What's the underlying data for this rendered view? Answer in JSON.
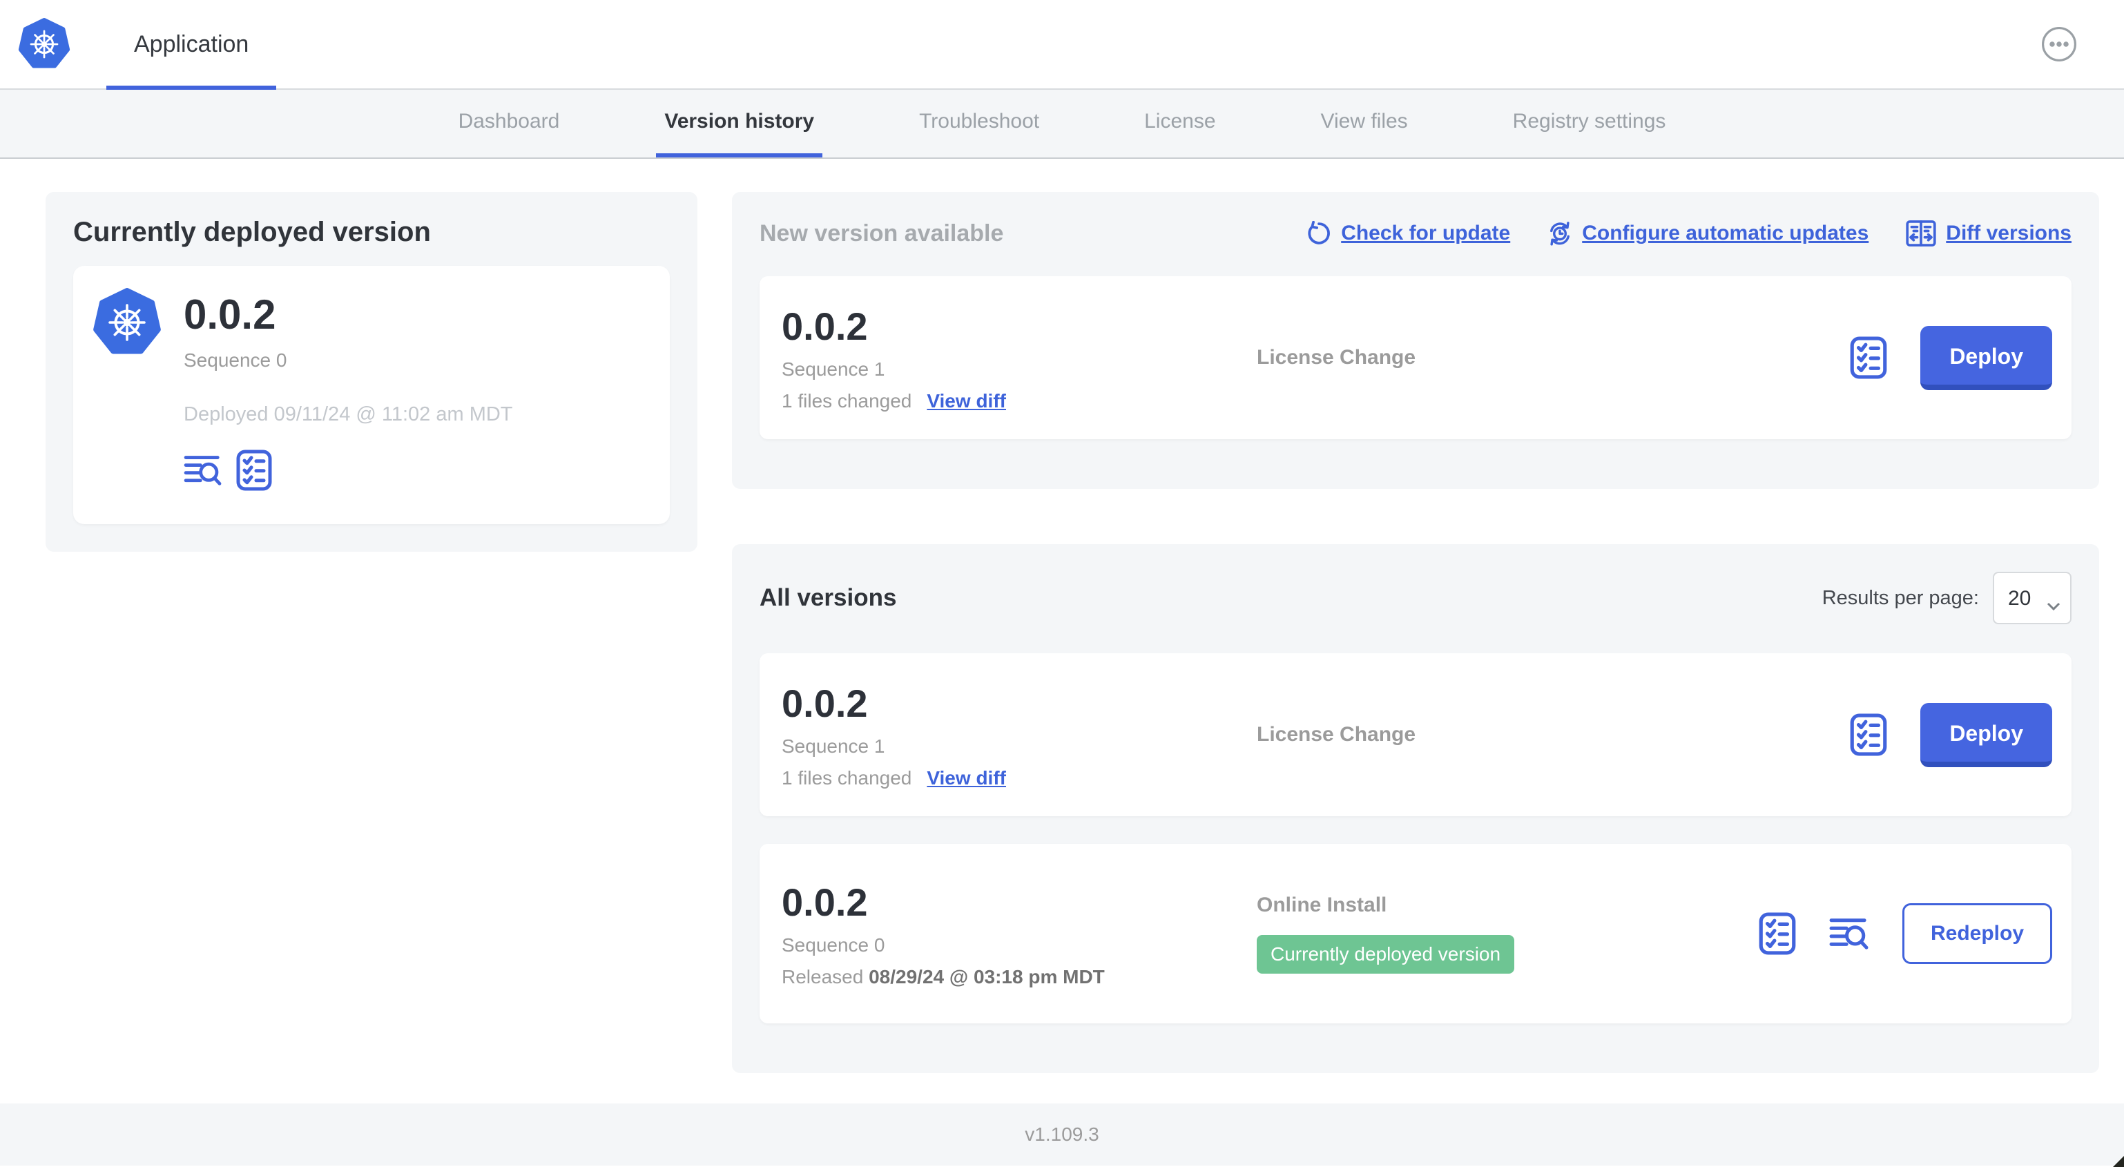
{
  "colors": {
    "accent_blue": "#4163dc",
    "link_blue": "#3e63da",
    "badge_green": "#6ec593",
    "k8s_logo_blue": "#3b6ce0"
  },
  "header": {
    "title": "Application"
  },
  "nav": {
    "active_tab": "Version history",
    "tabs": [
      {
        "label": "Dashboard"
      },
      {
        "label": "Version history"
      },
      {
        "label": "Troubleshoot"
      },
      {
        "label": "License"
      },
      {
        "label": "View files"
      },
      {
        "label": "Registry settings"
      }
    ]
  },
  "current_version_panel": {
    "title": "Currently deployed version",
    "version": "0.0.2",
    "sequence": "Sequence 0",
    "deployed": "Deployed 09/11/24 @ 11:02 am MDT"
  },
  "new_version_panel": {
    "title": "New version available",
    "actions": {
      "check_for_update": "Check for update",
      "configure_automatic_updates": "Configure automatic updates",
      "diff_versions": "Diff versions"
    },
    "card": {
      "version": "0.0.2",
      "sequence": "Sequence 1",
      "files_changed": "1 files changed",
      "view_diff_label": "View diff",
      "source": "License Change",
      "deploy_label": "Deploy"
    }
  },
  "all_versions_panel": {
    "title": "All versions",
    "results_per_page_label": "Results per page:",
    "results_per_page_value": "20",
    "rows": [
      {
        "version": "0.0.2",
        "sequence": "Sequence 1",
        "files_changed": "1 files changed",
        "view_diff_label": "View diff",
        "source": "License Change",
        "action_label": "Deploy"
      },
      {
        "version": "0.0.2",
        "sequence": "Sequence 0",
        "released_prefix": "Released",
        "released_date": "08/29/24 @ 03:18 pm MDT",
        "source": "Online Install",
        "badge": "Currently deployed version",
        "action_label": "Redeploy"
      }
    ]
  },
  "footer": {
    "app_manager_version": "v1.109.3"
  }
}
